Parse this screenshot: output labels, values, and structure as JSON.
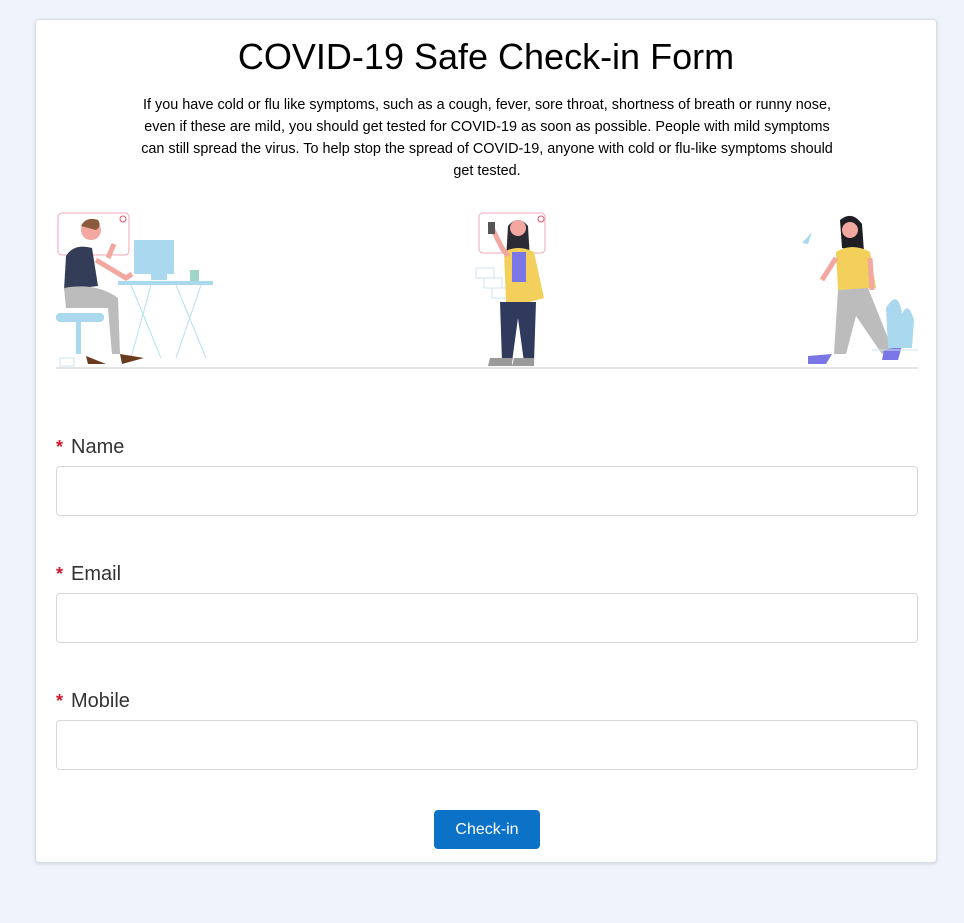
{
  "form": {
    "title": "COVID-19 Safe Check-in Form",
    "intro": "If you have cold or flu like symptoms, such as a cough, fever, sore throat, shortness of breath or runny nose, even if these are mild, you should get tested for COVID-19 as soon as possible. People with mild symptoms can still spread the virus. To help stop the spread of COVID-19, anyone with cold or flu-like symptoms should get tested.",
    "required_marker": "*",
    "fields": [
      {
        "label": "Name",
        "value": "",
        "placeholder": ""
      },
      {
        "label": "Email",
        "value": "",
        "placeholder": ""
      },
      {
        "label": "Mobile",
        "value": "",
        "placeholder": ""
      }
    ],
    "submit_label": "Check-in"
  },
  "colors": {
    "page_background": "#eef3fc",
    "required_marker": "#d1162c",
    "button": "#0b72c8"
  }
}
